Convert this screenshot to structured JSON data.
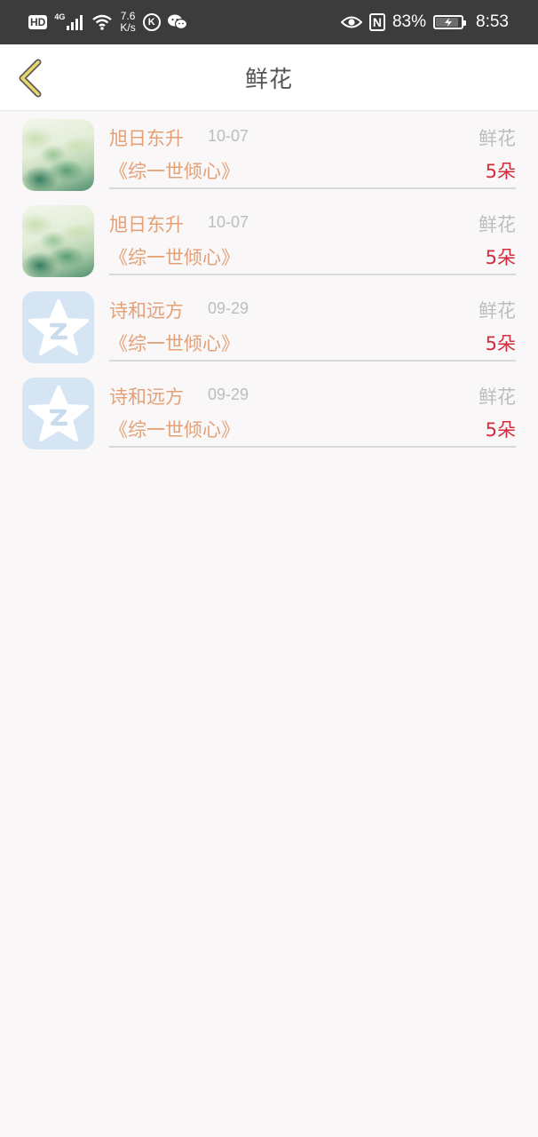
{
  "status_bar": {
    "hd_label": "HD",
    "network_type": "4G",
    "speed_value": "7.6",
    "speed_unit": "K/s",
    "k_label": "K",
    "nfc_label": "N",
    "battery_percent_text": "83%",
    "battery_level": 0.83,
    "time": "8:53"
  },
  "nav": {
    "title": "鲜花",
    "back_icon": "chevron-left-icon",
    "back_color": "#e8d66b"
  },
  "list": {
    "items": [
      {
        "avatar": "watercolor-landscape",
        "name": "旭日东升",
        "date": "10-07",
        "type": "鲜花",
        "book": "《综一世倾心》",
        "amount": "5朵"
      },
      {
        "avatar": "watercolor-landscape",
        "name": "旭日东升",
        "date": "10-07",
        "type": "鲜花",
        "book": "《综一世倾心》",
        "amount": "5朵"
      },
      {
        "avatar": "qq-star-logo",
        "name": "诗和远方",
        "date": "09-29",
        "type": "鲜花",
        "book": "《综一世倾心》",
        "amount": "5朵"
      },
      {
        "avatar": "qq-star-logo",
        "name": "诗和远方",
        "date": "09-29",
        "type": "鲜花",
        "book": "《综一世倾心》",
        "amount": "5朵"
      }
    ]
  },
  "colors": {
    "accent_text": "#e4a077",
    "amount_text": "#d32c3c",
    "muted_text": "#bdbdbd",
    "status_bar_bg": "#3c3c3c"
  }
}
